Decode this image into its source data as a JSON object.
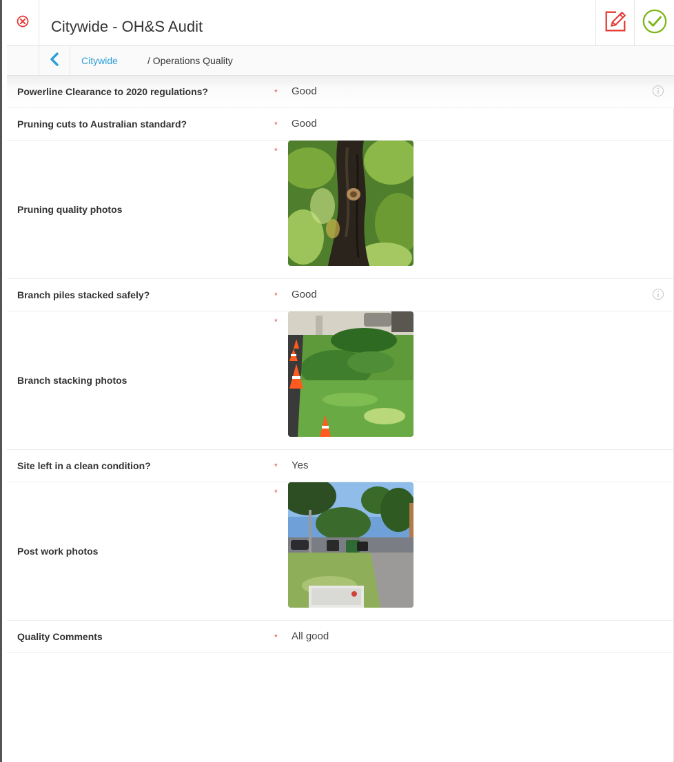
{
  "header": {
    "title": "Citywide - OH&S Audit",
    "icons": {
      "close": "close-circle-icon",
      "edit": "edit-icon",
      "confirm": "check-circle-icon"
    },
    "colors": {
      "close": "#e53935",
      "edit": "#e53935",
      "confirm": "#7cb518"
    }
  },
  "breadcrumb": {
    "back_icon": "chevron-left-icon",
    "link": "Citywide",
    "current": "/ Operations Quality",
    "link_color": "#2a9fd8"
  },
  "form": {
    "required_marker": "*",
    "rows": [
      {
        "label": "Powerline Clearance to 2020 regulations?",
        "value": "Good",
        "info_icon": true
      },
      {
        "label": "Pruning cuts to Australian standard?",
        "value": "Good"
      },
      {
        "label": "Pruning quality photos",
        "photo": "tree-trunk-photo"
      },
      {
        "label": "Branch piles stacked safely?",
        "value": "Good",
        "info_icon": true
      },
      {
        "label": "Branch stacking photos",
        "photo": "branch-stack-cones-photo"
      },
      {
        "label": "Site left in a clean condition?",
        "value": "Yes"
      },
      {
        "label": "Post work photos",
        "photo": "street-post-work-photo"
      },
      {
        "label": "Quality Comments",
        "value": "All good"
      }
    ]
  }
}
